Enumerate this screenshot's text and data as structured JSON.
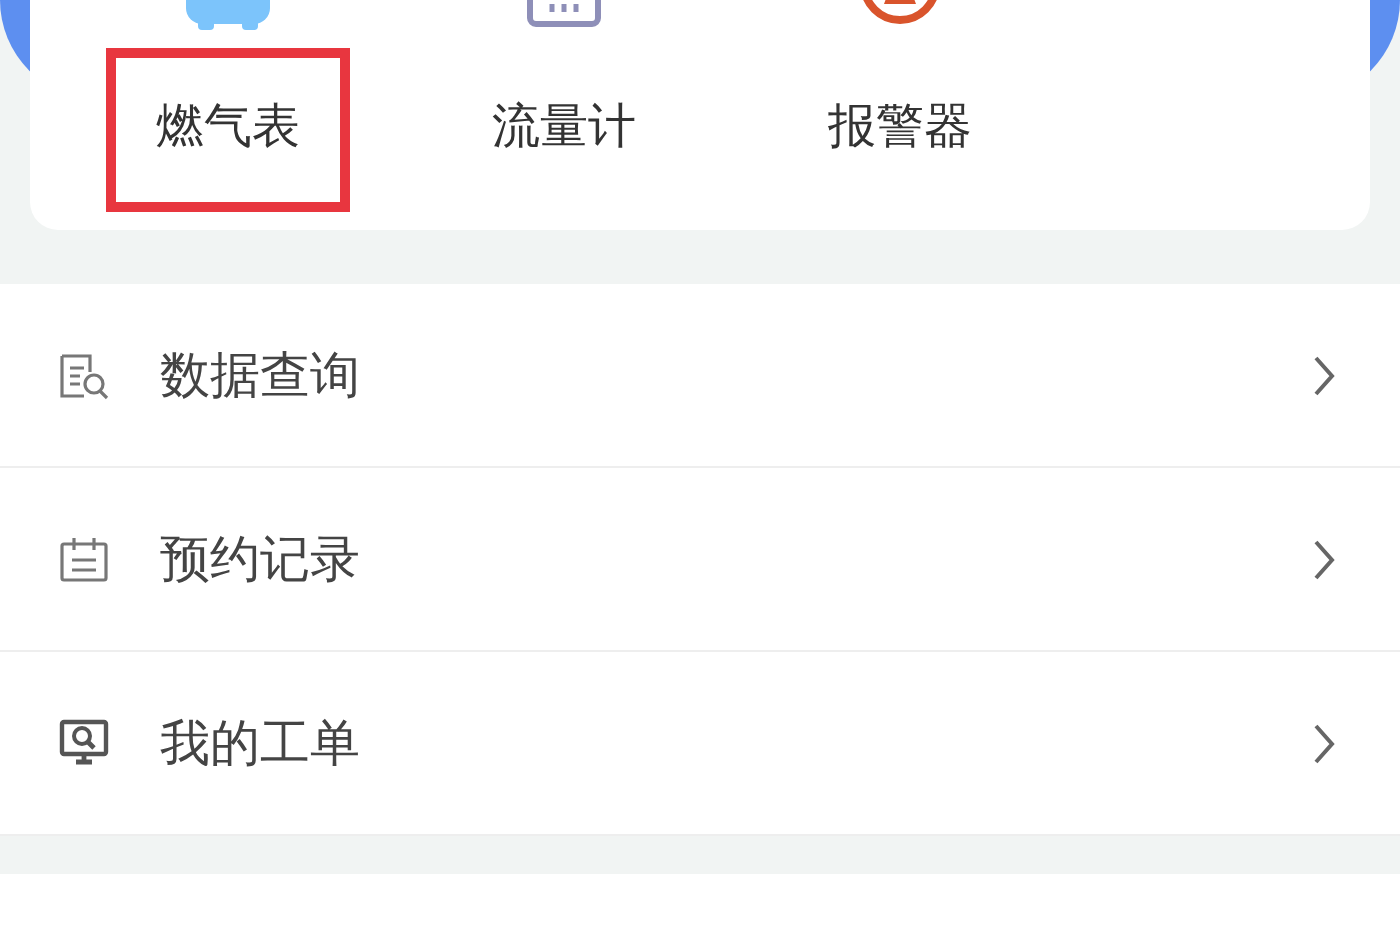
{
  "device_types": [
    {
      "label": "燃气表",
      "kind": "gas-meter",
      "highlighted": true
    },
    {
      "label": "流量计",
      "kind": "flow-meter",
      "highlighted": false
    },
    {
      "label": "报警器",
      "kind": "alarm",
      "highlighted": false
    }
  ],
  "menu": [
    {
      "label": "数据查询",
      "kind": "data"
    },
    {
      "label": "预约记录",
      "kind": "calendar"
    },
    {
      "label": "我的工单",
      "kind": "orders"
    }
  ]
}
